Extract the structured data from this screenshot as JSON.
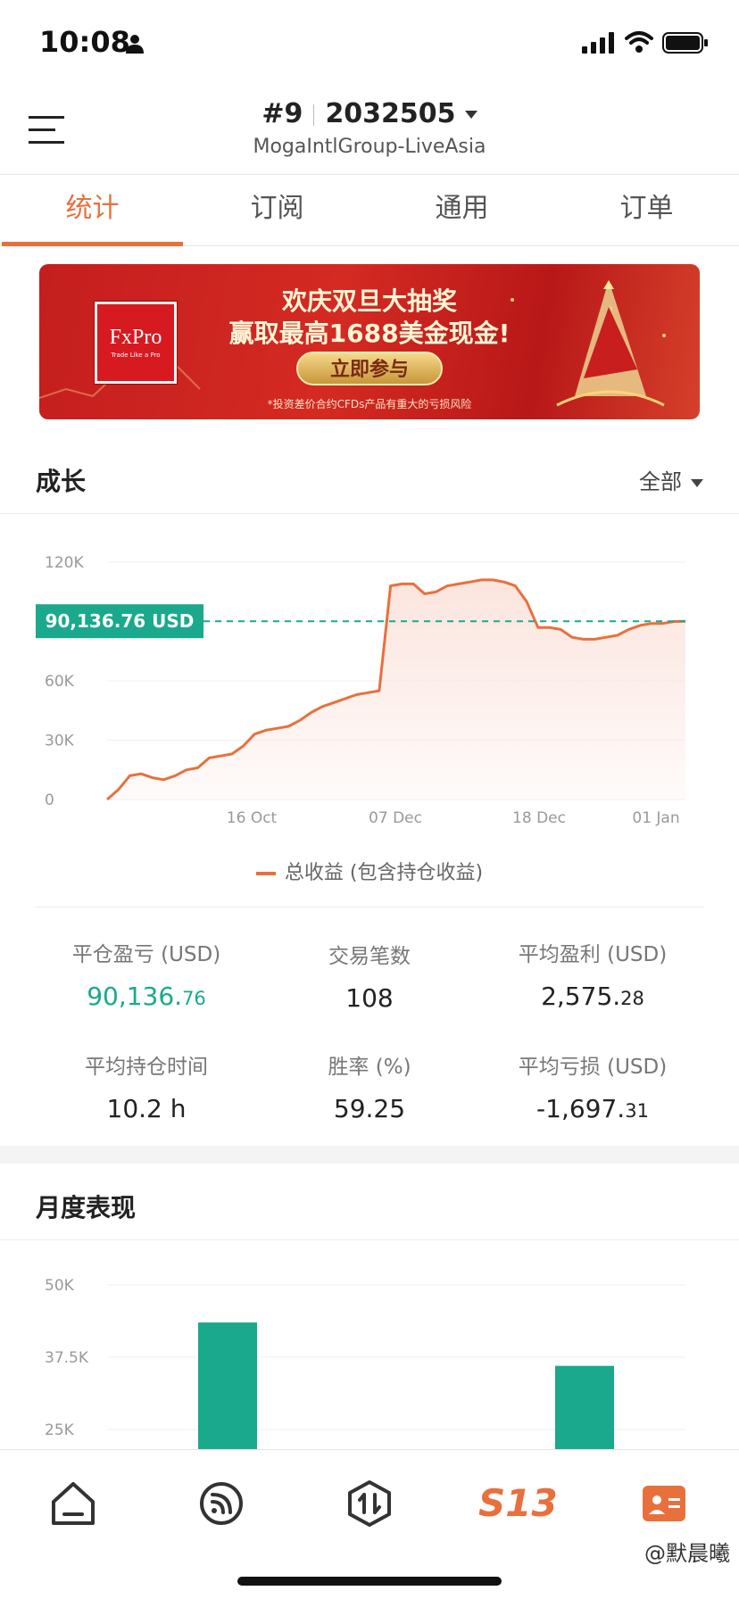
{
  "status_bar": {
    "time": "10:08"
  },
  "header": {
    "account_rank": "#9",
    "account_number": "2032505",
    "server": "MogaIntlGroup-LiveAsia"
  },
  "tabs": [
    {
      "label": "统计",
      "active": true
    },
    {
      "label": "订阅",
      "active": false
    },
    {
      "label": "通用",
      "active": false
    },
    {
      "label": "订单",
      "active": false
    }
  ],
  "banner": {
    "logo_text": "FxPro",
    "logo_tagline": "Trade Like a Pro",
    "title": "欢庆双旦大抽奖",
    "subtitle": "赢取最高1688美金现金!",
    "button": "立即参与",
    "risk_note": "*投资差价合约CFDs产品有重大的亏损风险"
  },
  "growth": {
    "title": "成长",
    "filter": "全部",
    "current_value_label": "90,136.76 USD",
    "legend": "总收益 (包含持仓收益)"
  },
  "stats": {
    "closed_pl_label": "平仓盈亏 (USD)",
    "closed_pl_int": "90,136.",
    "closed_pl_dec": "76",
    "trades_label": "交易笔数",
    "trades_value": "108",
    "avg_profit_label": "平均盈利 (USD)",
    "avg_profit_int": "2,575.",
    "avg_profit_dec": "28",
    "avg_hold_label": "平均持仓时间",
    "avg_hold_value": "10.2 h",
    "win_rate_label": "胜率 (%)",
    "win_rate_value": "59.25",
    "avg_loss_label": "平均亏损 (USD)",
    "avg_loss_int": "-1,697.",
    "avg_loss_dec": "31"
  },
  "monthly": {
    "title": "月度表现"
  },
  "nav": {
    "items": [
      "home-icon",
      "feed-icon",
      "trade-icon",
      "s13-icon",
      "profile-card-icon"
    ],
    "s13_label": "S13",
    "active_index": 4
  },
  "watermark": "@默晨曦",
  "colors": {
    "accent": "#e8703d",
    "green": "#1aa98c",
    "chart_fill": "#fbe3dc"
  },
  "chart_data": [
    {
      "type": "area",
      "ylim": [
        0,
        120000
      ],
      "yticks": [
        0,
        30000,
        60000,
        120000
      ],
      "ytick_labels": [
        "0",
        "30K",
        "60K",
        "120K"
      ],
      "xtick_labels": [
        "16 Oct",
        "07 Dec",
        "18 Dec",
        "01 Jan"
      ],
      "reference_value": 90136.76,
      "series": [
        {
          "name": "总收益 (包含持仓收益)",
          "values": [
            0,
            5000,
            12000,
            13000,
            11000,
            10000,
            12000,
            15000,
            16000,
            21000,
            22000,
            23000,
            27000,
            33000,
            35000,
            36000,
            37000,
            40000,
            44000,
            47000,
            49000,
            51000,
            53000,
            54000,
            55000,
            108000,
            109000,
            109000,
            104000,
            105000,
            108000,
            109000,
            110000,
            111000,
            111000,
            110000,
            108000,
            100000,
            87000,
            87000,
            86000,
            82000,
            81000,
            81000,
            82000,
            83000,
            86000,
            88000,
            89000,
            89000,
            90000,
            90136.76
          ]
        }
      ]
    },
    {
      "type": "bar",
      "ylim": [
        25000,
        50000
      ],
      "yticks": [
        25000,
        37500,
        50000
      ],
      "ytick_labels": [
        "25K",
        "37.5K",
        "50K"
      ],
      "series": [
        {
          "values": [
            null,
            43500,
            null,
            null,
            null,
            null,
            null,
            36000,
            null
          ]
        }
      ]
    }
  ]
}
